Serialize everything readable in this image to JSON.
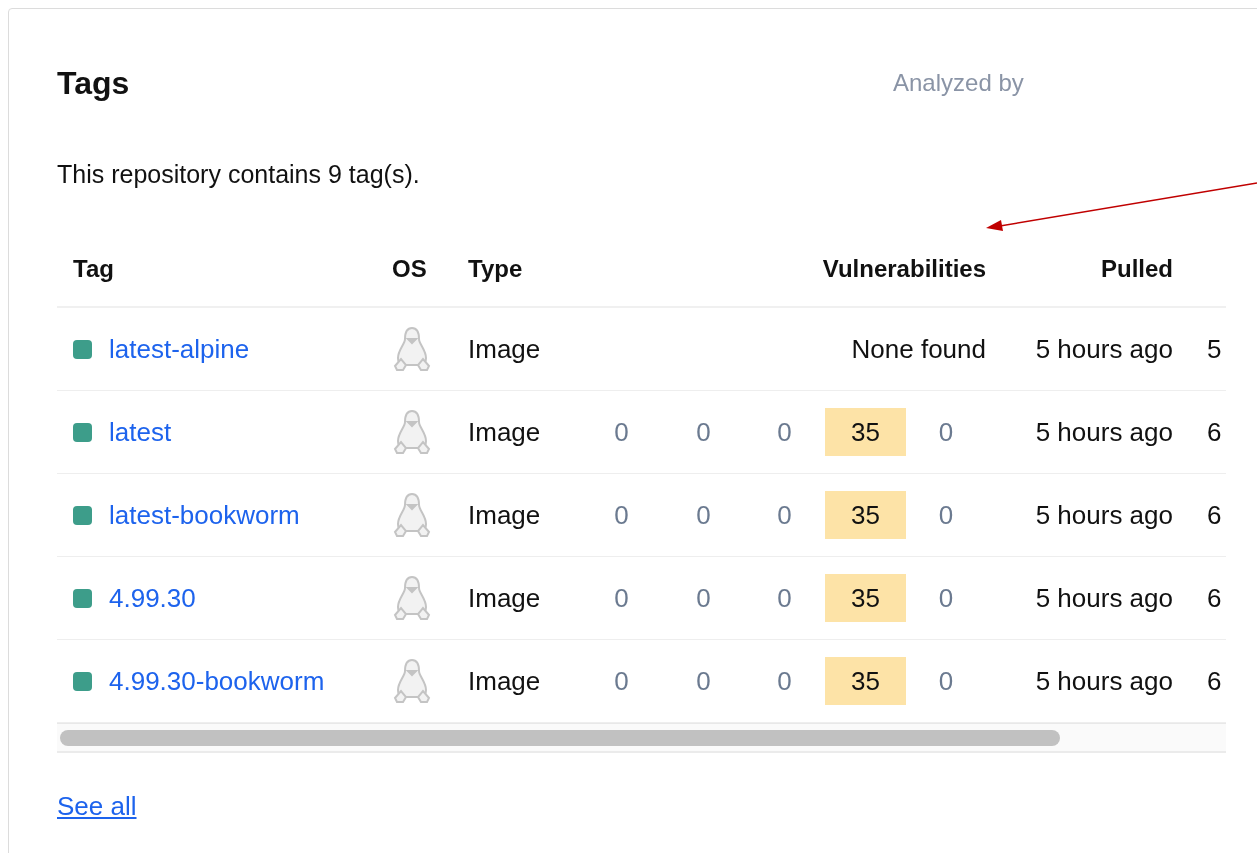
{
  "card": {
    "title": "Tags",
    "analyzed_by": "Analyzed by",
    "description": "This repository contains 9 tag(s)."
  },
  "table": {
    "columns": [
      "Tag",
      "OS",
      "Type",
      "Vulnerabilities",
      "Pulled"
    ],
    "rows": [
      {
        "tag": "latest-alpine",
        "color": "#3d9d8a",
        "type": "Image",
        "vulnerabilities": {
          "kind": "text",
          "text": "None found"
        },
        "pulled": "5 hours ago",
        "column_7": "5"
      },
      {
        "tag": "latest",
        "color": "#3d9d8a",
        "type": "Image",
        "vulnerabilities": {
          "kind": "counts",
          "counts": [
            {
              "value": "0",
              "highlighted": false
            },
            {
              "value": "0",
              "highlighted": false
            },
            {
              "value": "0",
              "highlighted": false
            },
            {
              "value": "35",
              "highlighted": true
            },
            {
              "value": "0",
              "highlighted": false
            }
          ]
        },
        "pulled": "5 hours ago",
        "column_7": "6"
      },
      {
        "tag": "latest-bookworm",
        "color": "#3d9d8a",
        "type": "Image",
        "vulnerabilities": {
          "kind": "counts",
          "counts": [
            {
              "value": "0",
              "highlighted": false
            },
            {
              "value": "0",
              "highlighted": false
            },
            {
              "value": "0",
              "highlighted": false
            },
            {
              "value": "35",
              "highlighted": true
            },
            {
              "value": "0",
              "highlighted": false
            }
          ]
        },
        "pulled": "5 hours ago",
        "column_7": "6"
      },
      {
        "tag": "4.99.30",
        "color": "#3d9d8a",
        "type": "Image",
        "vulnerabilities": {
          "kind": "counts",
          "counts": [
            {
              "value": "0",
              "highlighted": false
            },
            {
              "value": "0",
              "highlighted": false
            },
            {
              "value": "0",
              "highlighted": false
            },
            {
              "value": "35",
              "highlighted": true
            },
            {
              "value": "0",
              "highlighted": false
            }
          ]
        },
        "pulled": "5 hours ago",
        "column_7": "6"
      },
      {
        "tag": "4.99.30-bookworm",
        "color": "#3d9d8a",
        "type": "Image",
        "vulnerabilities": {
          "kind": "counts",
          "counts": [
            {
              "value": "0",
              "highlighted": false
            },
            {
              "value": "0",
              "highlighted": false
            },
            {
              "value": "0",
              "highlighted": false
            },
            {
              "value": "35",
              "highlighted": true
            },
            {
              "value": "0",
              "highlighted": false
            }
          ]
        },
        "pulled": "5 hours ago",
        "column_7": "6"
      }
    ]
  },
  "see_all": "See all"
}
